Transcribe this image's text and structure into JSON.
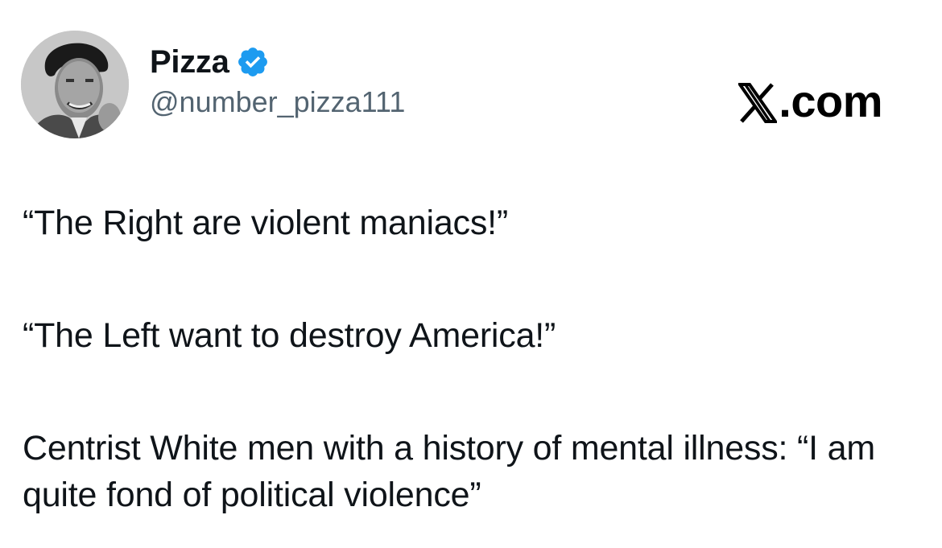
{
  "brand": {
    "text": ".com",
    "icon": "x-logo-icon"
  },
  "author": {
    "display_name": "Pizza",
    "handle": "@number_pizza111",
    "verified": true,
    "verified_color": "#1d9bf0"
  },
  "tweet": {
    "paragraphs": [
      "“The Right are violent maniacs!”",
      "“The Left want to destroy America!”",
      "Centrist White men with a history of mental illness: “I am quite fond of political violence”"
    ]
  },
  "colors": {
    "text": "#0f1419",
    "secondary": "#536471",
    "background": "#ffffff"
  }
}
